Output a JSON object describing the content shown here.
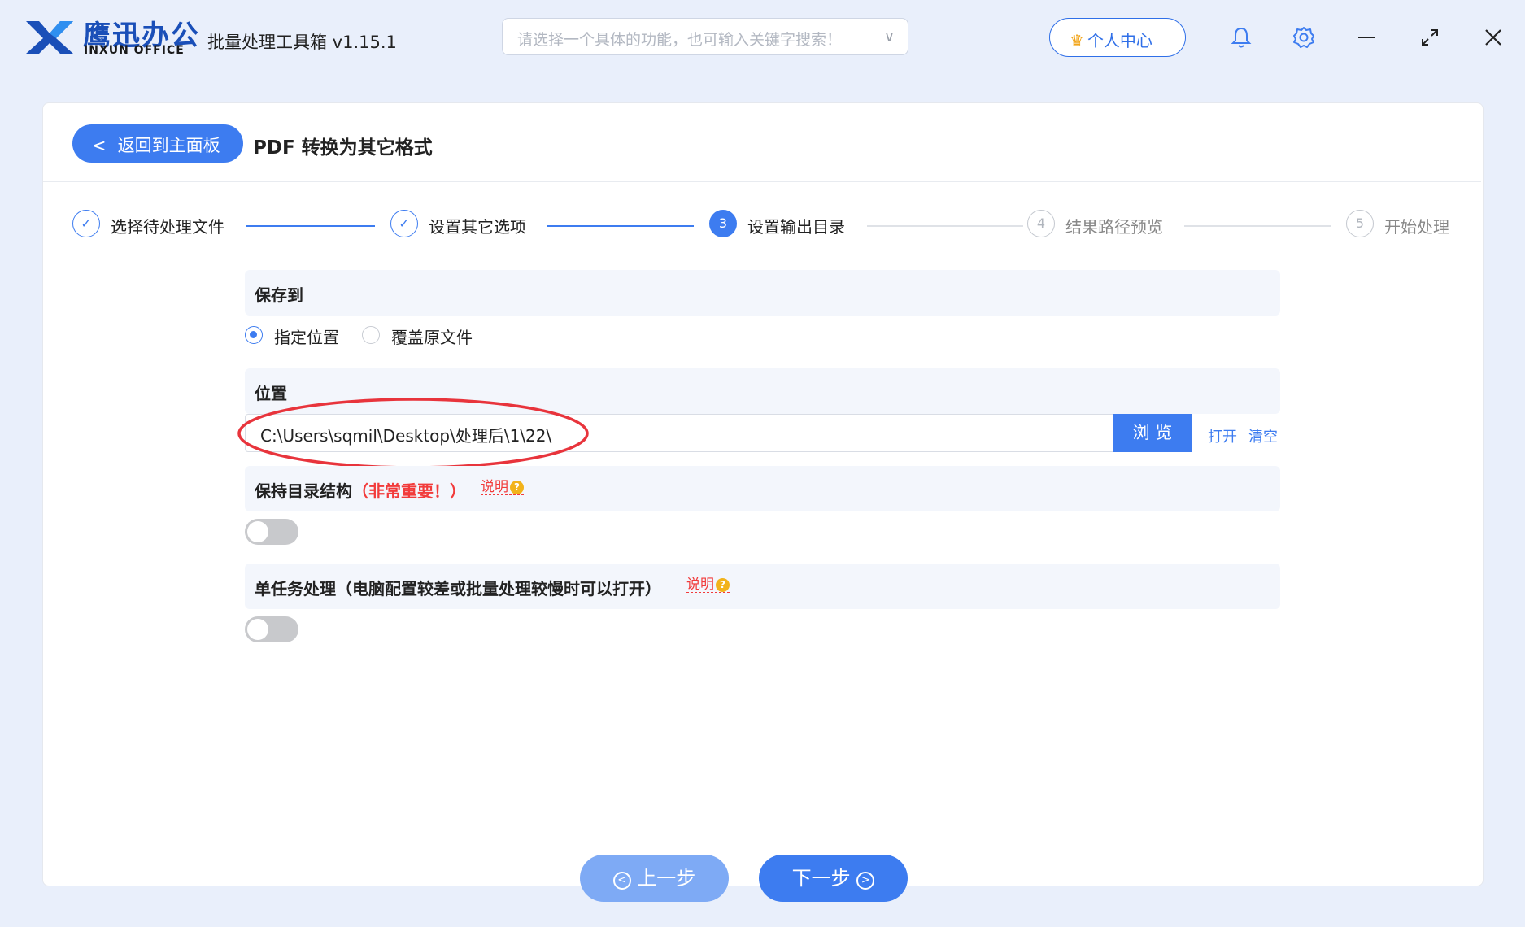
{
  "header": {
    "brand_cn": "鹰迅办公",
    "brand_en": "INXUN OFFICE",
    "app_title": "批量处理工具箱 v1.15.1",
    "search_placeholder": "请选择一个具体的功能，也可输入关键字搜索！",
    "user_center_label": "个人中心"
  },
  "page": {
    "back_label": "返回到主面板",
    "title": "PDF 转换为其它格式"
  },
  "steps": [
    {
      "num": "✓",
      "label": "选择待处理文件",
      "state": "done"
    },
    {
      "num": "✓",
      "label": "设置其它选项",
      "state": "done"
    },
    {
      "num": "3",
      "label": "设置输出目录",
      "state": "active"
    },
    {
      "num": "4",
      "label": "结果路径预览",
      "state": "pending"
    },
    {
      "num": "5",
      "label": "开始处理",
      "state": "pending"
    }
  ],
  "save_to": {
    "heading": "保存到",
    "options": [
      "指定位置",
      "覆盖原文件"
    ],
    "selected": "指定位置"
  },
  "location": {
    "heading": "位置",
    "path": "C:\\Users\\sqmil\\Desktop\\处理后\\1\\22\\",
    "browse_label": "浏 览",
    "open_label": "打开",
    "clear_label": "清空"
  },
  "keep_structure": {
    "heading": "保持目录结构",
    "warning": "（非常重要！）",
    "help": "说明",
    "enabled": false
  },
  "single_task": {
    "heading": "单任务处理（电脑配置较差或批量处理较慢时可以打开）",
    "help": "说明",
    "enabled": false
  },
  "footer": {
    "prev_label": "上一步",
    "next_label": "下一步"
  },
  "colors": {
    "accent": "#3d7cf0",
    "warning": "#f23b3b",
    "highlight_ellipse": "#e8343c"
  }
}
